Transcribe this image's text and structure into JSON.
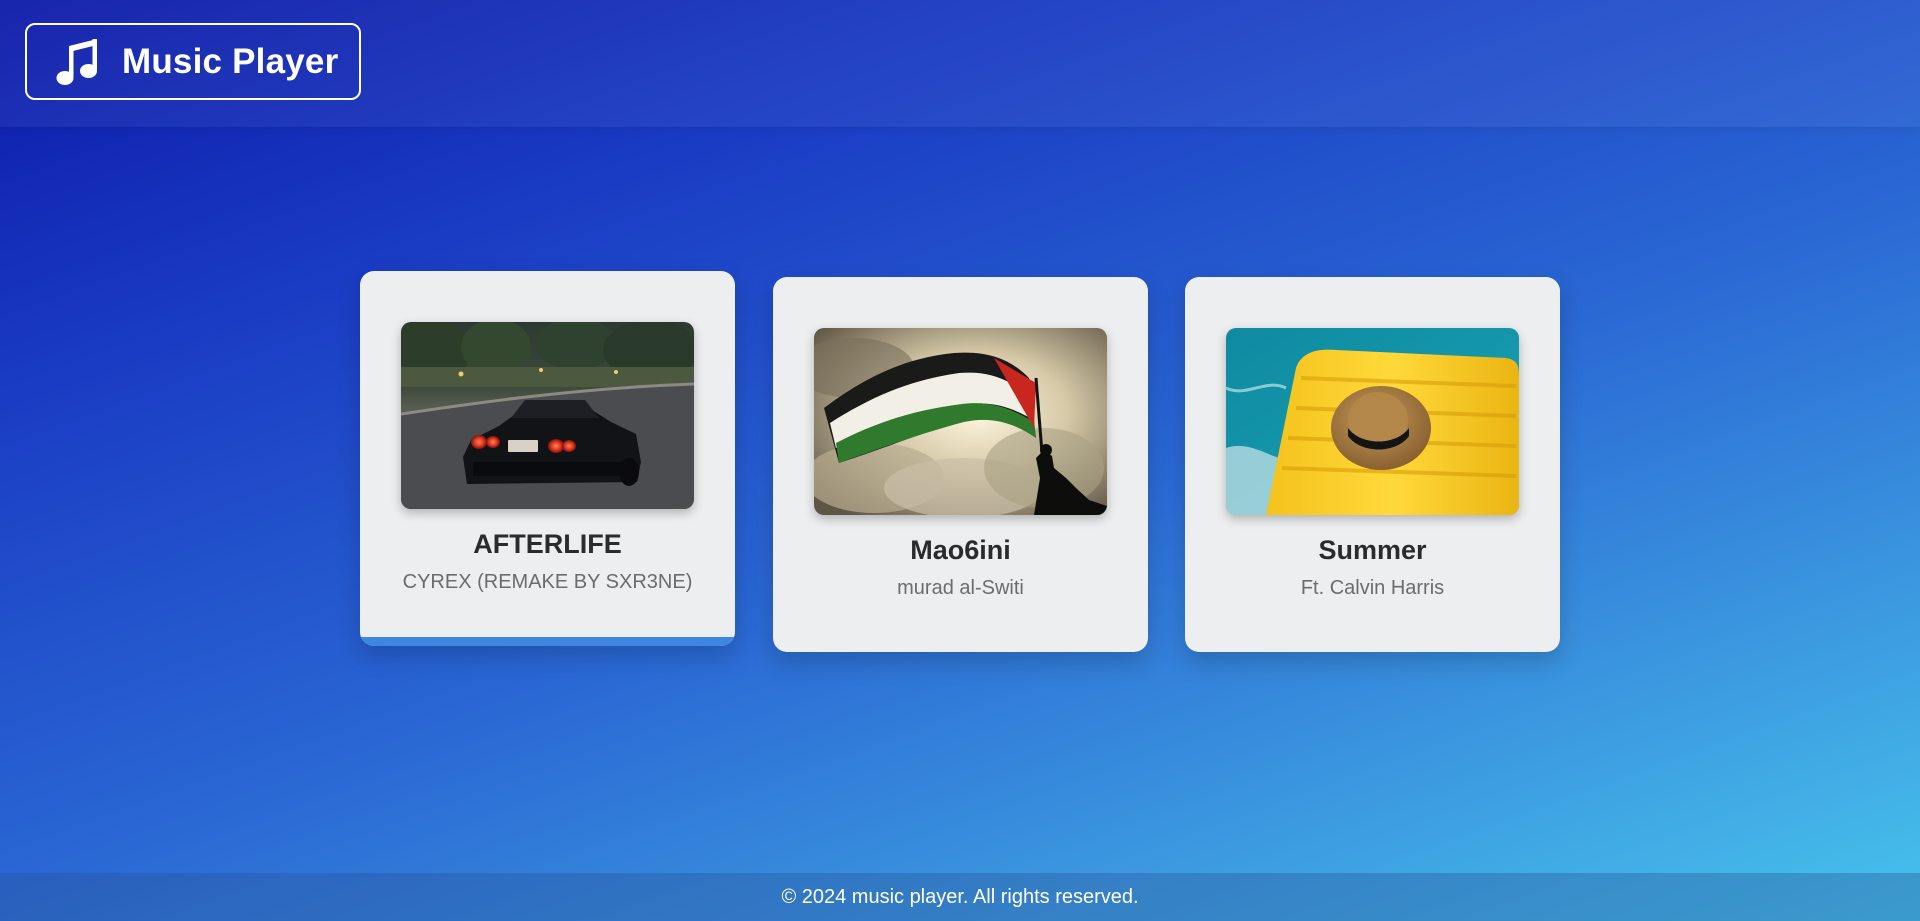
{
  "header": {
    "logo_icon": "music-note-icon",
    "title": "Music Player"
  },
  "songs": [
    {
      "title": "AFTERLIFE",
      "artist": "CYREX (REMAKE BY SXR3NE)",
      "cover": "car-night-road-image",
      "active": true
    },
    {
      "title": "Mao6ini",
      "artist": "murad al-Switi",
      "cover": "flag-waving-silhouette-image",
      "active": false
    },
    {
      "title": "Summer",
      "artist": "Ft. Calvin Harris",
      "cover": "hat-on-pool-float-image",
      "active": false
    }
  ],
  "footer": {
    "text": "© 2024 music player. All rights reserved."
  },
  "colors": {
    "accent": "#3f86e0",
    "card_background": "#eceeef",
    "header_text": "#ffffff"
  }
}
